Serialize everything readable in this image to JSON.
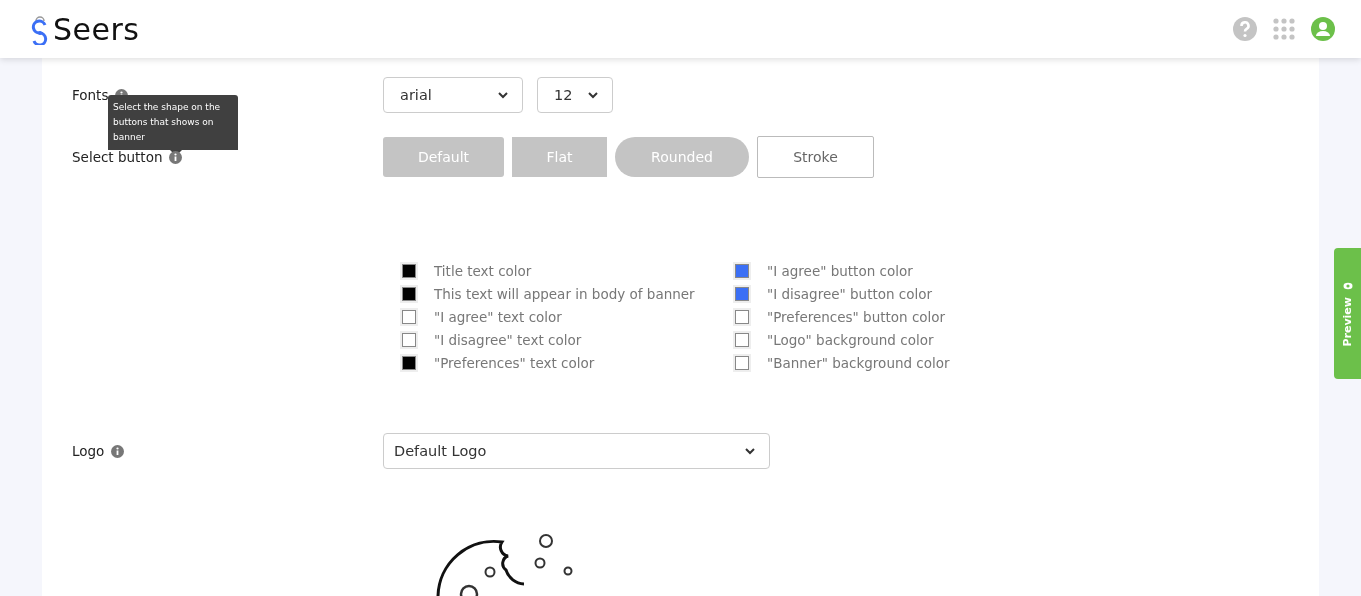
{
  "header": {
    "brand": "Seers"
  },
  "fonts": {
    "label": "Fonts",
    "family": "arial",
    "size": "12"
  },
  "tooltip": {
    "text": "Select the shape on the buttons that shows on banner"
  },
  "button_shapes": {
    "label": "Select button",
    "options": [
      {
        "label": "Default",
        "kind": "default"
      },
      {
        "label": "Flat",
        "kind": "flat"
      },
      {
        "label": "Rounded",
        "kind": "rounded"
      },
      {
        "label": "Stroke",
        "kind": "stroke"
      }
    ]
  },
  "colors_left": [
    {
      "label": "Title text color",
      "color": "#000000"
    },
    {
      "label": "This text will appear in body of banner",
      "color": "#000000"
    },
    {
      "label": "\"I agree\" text color",
      "color": "#ffffff"
    },
    {
      "label": "\"I disagree\" text color",
      "color": "#ffffff"
    },
    {
      "label": "\"Preferences\" text color",
      "color": "#000000"
    }
  ],
  "colors_right": [
    {
      "label": "\"I agree\" button color",
      "color": "#3b6ff5"
    },
    {
      "label": "\"I disagree\" button color",
      "color": "#3b6ff5"
    },
    {
      "label": "\"Preferences\" button color",
      "color": "#ffffff"
    },
    {
      "label": "\"Logo\" background color",
      "color": "#ffffff"
    },
    {
      "label": "\"Banner\" background color",
      "color": "#ffffff"
    }
  ],
  "logo": {
    "label": "Logo",
    "value": "Default Logo"
  },
  "preview_tab": {
    "label": "Preview"
  }
}
